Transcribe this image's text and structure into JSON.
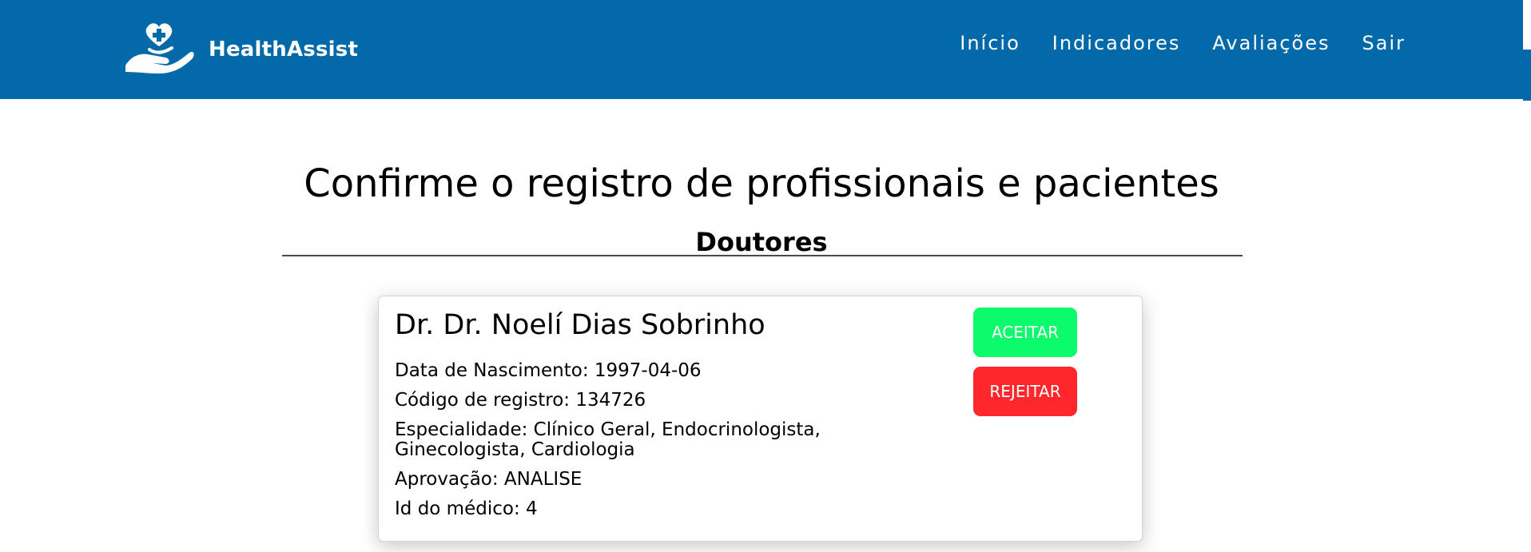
{
  "brand": {
    "name": "HealthAssist",
    "logo_icon": "hand-heart-plus-icon"
  },
  "nav": {
    "items": [
      {
        "label": "Início"
      },
      {
        "label": "Indicadores"
      },
      {
        "label": "Avaliações"
      },
      {
        "label": "Sair"
      }
    ]
  },
  "page": {
    "title": "Confirme o registro de profissionais e pacientes",
    "section": "Doutores"
  },
  "card": {
    "name": "Dr. Dr. Noelí Dias Sobrinho",
    "birth": "Data de Nascimento: 1997-04-06",
    "registration": "Código de registro: 134726",
    "specialty": "Especialidade: Clínico Geral, Endocrinologista, Ginecologista, Cardiologia",
    "approval": "Aprovação: ANALISE",
    "doctor_id": "Id do médico: 4",
    "accept_label": "ACEITAR",
    "reject_label": "REJEITAR"
  },
  "colors": {
    "navbar": "#0369a8",
    "accept": "#0cfb6a",
    "reject": "#ff262c"
  }
}
